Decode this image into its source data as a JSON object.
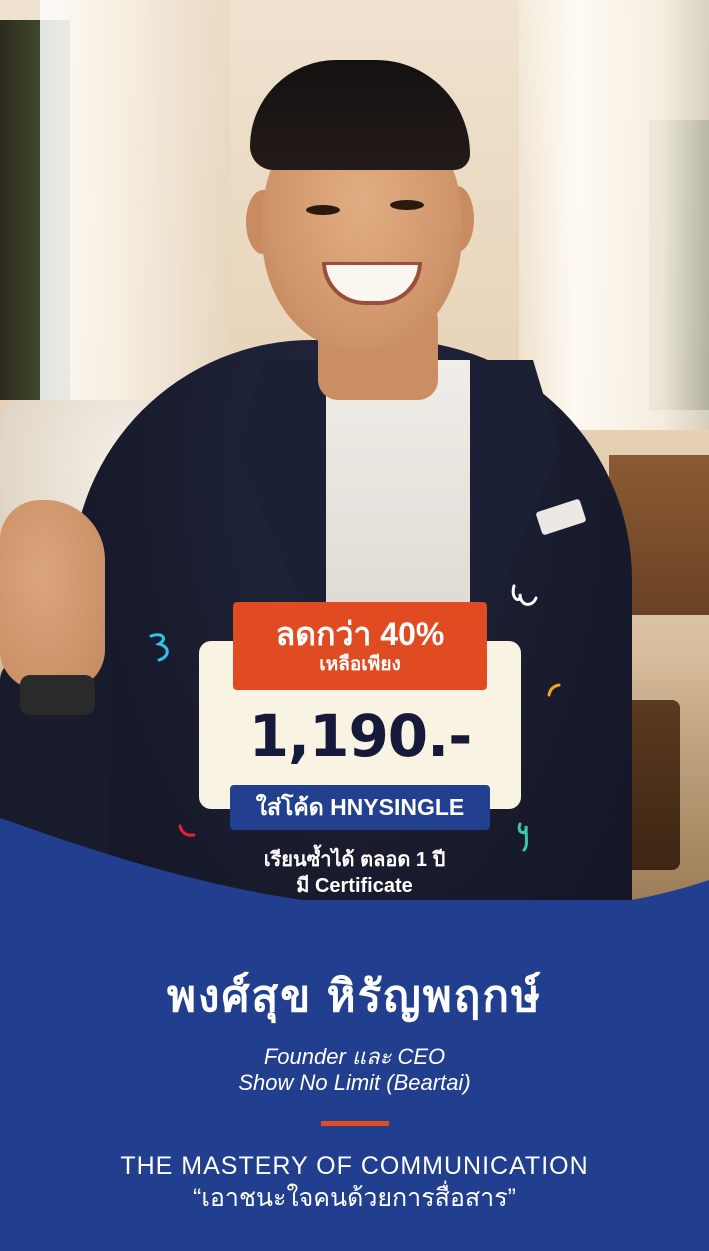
{
  "promo": {
    "discount_title": "ลดกว่า 40%",
    "discount_subtitle": "เหลือเพียง",
    "price": "1,190.-",
    "code_label": "ใส่โค้ด HNYSINGLE",
    "feature_1": "เรียนซ้ำได้ ตลอด 1 ปี",
    "feature_2": "มี Certificate"
  },
  "instructor": {
    "name": "พงศ์สุข หิรัญพฤกษ์",
    "role_1": "Founder และ CEO",
    "role_2": "Show No Limit (Beartai)"
  },
  "course": {
    "title": "THE MASTERY OF COMMUNICATION",
    "subtitle": "“เอาชนะใจคนด้วยการสื่อสาร”"
  },
  "colors": {
    "brand_blue": "#223f8f",
    "accent_orange": "#e14b22",
    "card_cream": "#f9f3e3",
    "price_navy": "#151a3a"
  }
}
